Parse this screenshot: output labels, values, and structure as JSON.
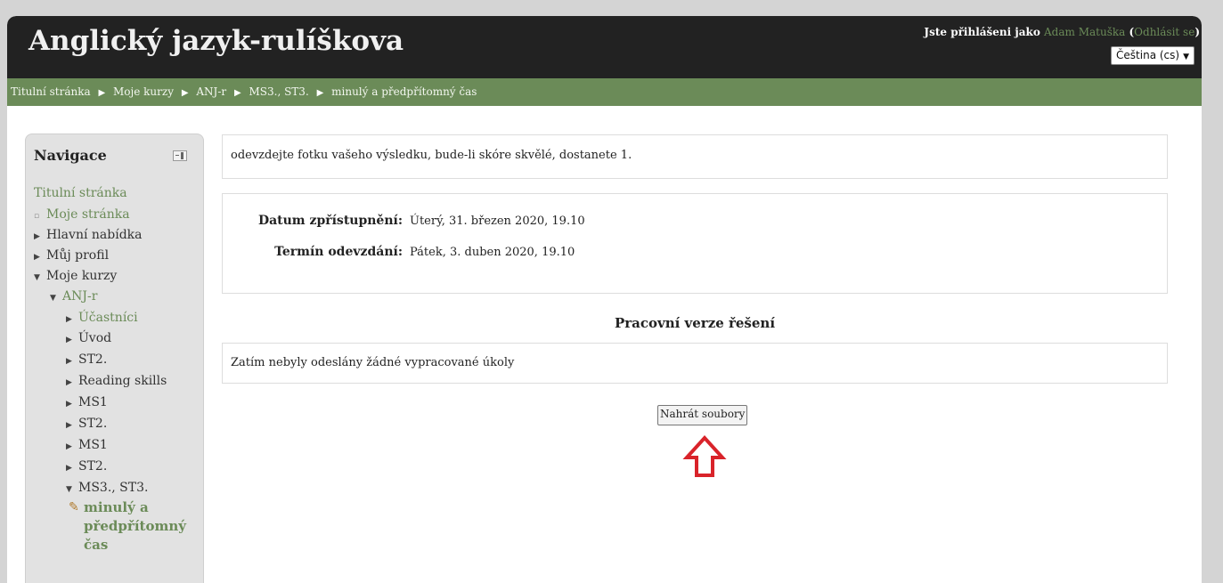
{
  "header": {
    "site_title": "Anglický jazyk-rulíškova",
    "login_prefix": "Jste přihlášeni jako",
    "user_name": "Adam Matuška",
    "logout_label": "Odhlásit se",
    "language": "Čeština (cs)"
  },
  "breadcrumb": [
    "Titulní stránka",
    "Moje kurzy",
    "ANJ-r",
    "MS3., ST3.",
    "minulý a předpřítomný čas"
  ],
  "navigation": {
    "title": "Navigace",
    "items": [
      {
        "label": "Titulní stránka"
      },
      {
        "label": "Moje stránka"
      },
      {
        "label": "Hlavní nabídka"
      },
      {
        "label": "Můj profil"
      },
      {
        "label": "Moje kurzy"
      },
      {
        "label": "ANJ-r"
      },
      {
        "label": "Účastníci"
      },
      {
        "label": "Úvod"
      },
      {
        "label": "ST2."
      },
      {
        "label": "Reading skills"
      },
      {
        "label": "MS1"
      },
      {
        "label": "ST2."
      },
      {
        "label": "MS1"
      },
      {
        "label": "ST2."
      },
      {
        "label": "MS3., ST3."
      }
    ],
    "current": "minulý a předpřítomný čas"
  },
  "main": {
    "intro": "odevzdejte fotku vašeho výsledku, bude-li skóre skvělé, dostanete 1.",
    "dates": [
      {
        "label": "Datum zpřístupnění:",
        "value": "Úterý, 31. březen 2020, 19.10"
      },
      {
        "label": "Termín odevzdání:",
        "value": "Pátek, 3. duben 2020, 19.10"
      }
    ],
    "section_heading": "Pracovní verze řešení",
    "status_text": "Zatím nebyly odeslány žádné vypracované úkoly",
    "upload_button": "Nahrát soubory"
  },
  "colors": {
    "header_bg": "#222222",
    "accent_green": "#6b8b58",
    "annotation_red": "#d9232a"
  }
}
